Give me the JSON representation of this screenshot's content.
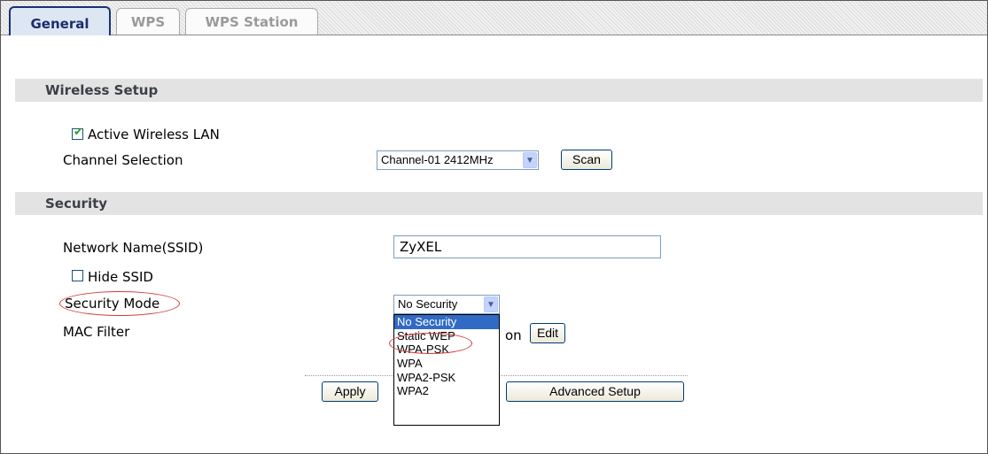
{
  "tabs": [
    {
      "label": "General"
    },
    {
      "label": "WPS"
    },
    {
      "label": "WPS Station"
    }
  ],
  "wireless_setup": {
    "title": "Wireless Setup",
    "active_wireless_lan_label": "Active Wireless LAN",
    "active_wireless_lan_checked": true,
    "channel_selection_label": "Channel Selection",
    "channel_value": "Channel-01 2412MHz",
    "scan_label": "Scan"
  },
  "security": {
    "title": "Security",
    "ssid_label": "Network Name(SSID)",
    "ssid_value": "ZyXEL",
    "hide_ssid_label": "Hide SSID",
    "hide_ssid_checked": false,
    "security_mode_label": "Security Mode",
    "security_mode_value": "No Security",
    "security_mode_options": [
      "No Security",
      "Static WEP",
      "WPA-PSK",
      "WPA",
      "WPA2-PSK",
      "WPA2"
    ],
    "mac_filter_label": "MAC Filter",
    "mac_filter_partial_text": "on",
    "edit_label": "Edit"
  },
  "actions": {
    "apply_label": "Apply",
    "advanced_label": "Advanced Setup"
  },
  "annotation_color": "#d23a3a",
  "select_highlight_color": "#316ac5"
}
